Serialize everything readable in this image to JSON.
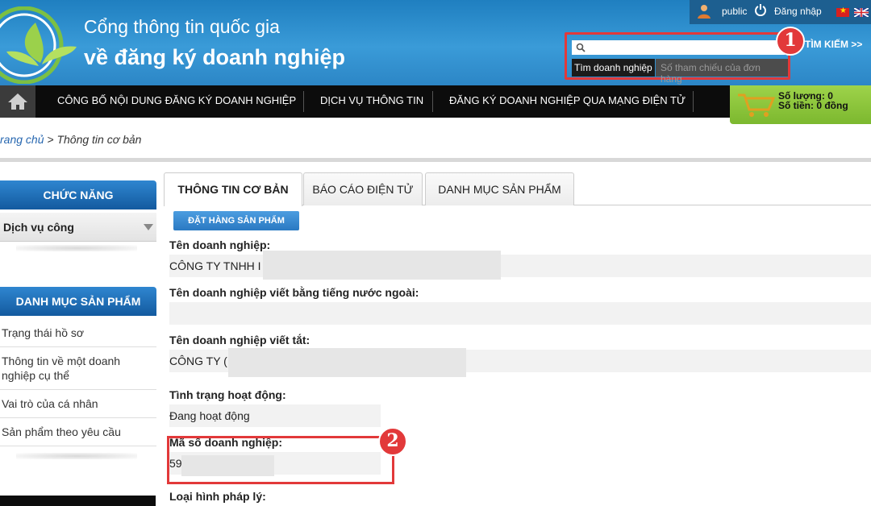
{
  "header": {
    "title_line1": "Cổng thông tin quốc gia",
    "title_line2": "về đăng ký doanh nghiệp",
    "user": "public",
    "login": "Đăng nhập",
    "search": {
      "placeholder": "",
      "button": "TÌM KIẾM >>",
      "tab_company": "Tìm doanh nghiệp",
      "tab_reference": "Số tham chiếu của đơn hàng"
    }
  },
  "badges": {
    "one": "1",
    "two": "2"
  },
  "nav": {
    "items": [
      "CÔNG BỐ NỘI DUNG ĐĂNG KÝ DOANH NGHIỆP",
      "DỊCH VỤ THÔNG TIN",
      "ĐĂNG KÝ DOANH NGHIỆP QUA MẠNG ĐIỆN TỬ"
    ],
    "cart_qty": "Số lượng: 0",
    "cart_amount": "Số tiền: 0 đồng"
  },
  "breadcrumb": {
    "home": "rang chủ",
    "sep": " > ",
    "current": "Thông tin cơ bản"
  },
  "sidebar": {
    "functions_header": "CHỨC NĂNG",
    "functions_select": "Dịch vụ công",
    "products_header": "DANH MỤC SẢN PHẨM",
    "items": [
      "Trạng thái hồ sơ",
      "Thông tin về một doanh nghiệp cụ thể",
      "Vai trò của cá nhân",
      "Sản phẩm theo yêu cầu"
    ]
  },
  "main": {
    "tabs": [
      "THÔNG TIN CƠ BẢN",
      "BÁO CÁO ĐIỆN TỬ",
      "DANH MỤC SẢN PHẨM"
    ],
    "order_button": "ĐẶT HÀNG SẢN PHẨM",
    "fields": {
      "name_label": "Tên doanh nghiệp:",
      "name_value": "CÔNG TY TNHH I",
      "foreign_label": "Tên doanh nghiệp viết bằng tiếng nước ngoài:",
      "foreign_value": "",
      "short_label": "Tên doanh nghiệp viết tắt:",
      "short_value": "CÔNG TY (",
      "status_label": "Tình trạng hoạt động:",
      "status_value": "Đang hoạt động",
      "code_label": "Mã số doanh nghiệp:",
      "code_value": "59",
      "type_label": "Loại hình pháp lý:"
    }
  },
  "colors": {
    "header_blue": "#2c86c6",
    "nav_black": "#0c0c0c",
    "cart_green": "#8cc63f",
    "highlight_red": "#e2393a",
    "link_blue": "#2767b0"
  }
}
